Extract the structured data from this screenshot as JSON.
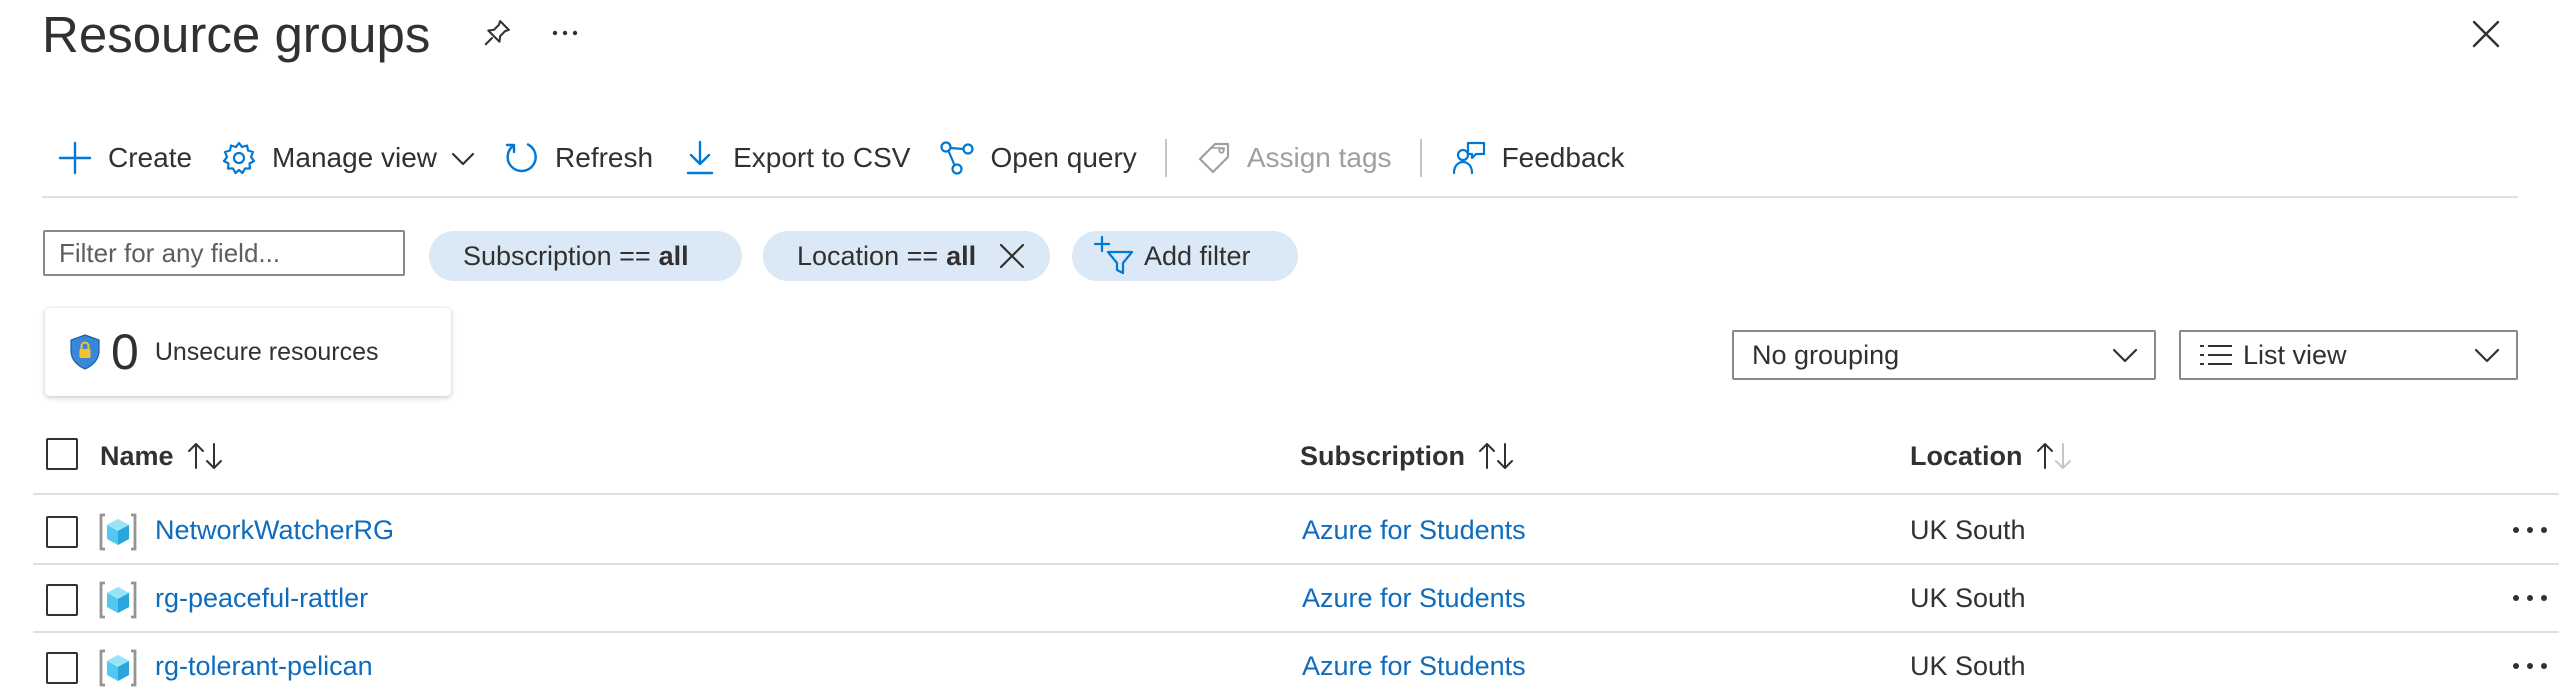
{
  "header": {
    "title": "Resource groups",
    "pin_icon": "pin-icon",
    "more_icon": "more-horizontal-icon",
    "close_icon": "close-icon"
  },
  "toolbar": {
    "create": "Create",
    "manage_view": "Manage view",
    "refresh": "Refresh",
    "export_csv": "Export to CSV",
    "open_query": "Open query",
    "assign_tags": "Assign tags",
    "feedback": "Feedback"
  },
  "filters": {
    "search_placeholder": "Filter for any field...",
    "subscription_label": "Subscription ==",
    "subscription_value": "all",
    "location_label": "Location ==",
    "location_value": "all",
    "add_filter": "Add filter"
  },
  "security_card": {
    "count": "0",
    "label": "Unsecure resources"
  },
  "grouping": {
    "selected": "No grouping"
  },
  "view": {
    "selected": "List view"
  },
  "table": {
    "columns": {
      "name": "Name",
      "subscription": "Subscription",
      "location": "Location"
    },
    "rows": [
      {
        "name": "NetworkWatcherRG",
        "subscription": "Azure for Students",
        "location": "UK South"
      },
      {
        "name": "rg-peaceful-rattler",
        "subscription": "Azure for Students",
        "location": "UK South"
      },
      {
        "name": "rg-tolerant-pelican",
        "subscription": "Azure for Students",
        "location": "UK South"
      }
    ]
  },
  "colors": {
    "link": "#0f6cbd",
    "accent": "#0078d4",
    "pill": "#dbe9f7",
    "text": "#323130",
    "disabled": "#a19f9d"
  }
}
